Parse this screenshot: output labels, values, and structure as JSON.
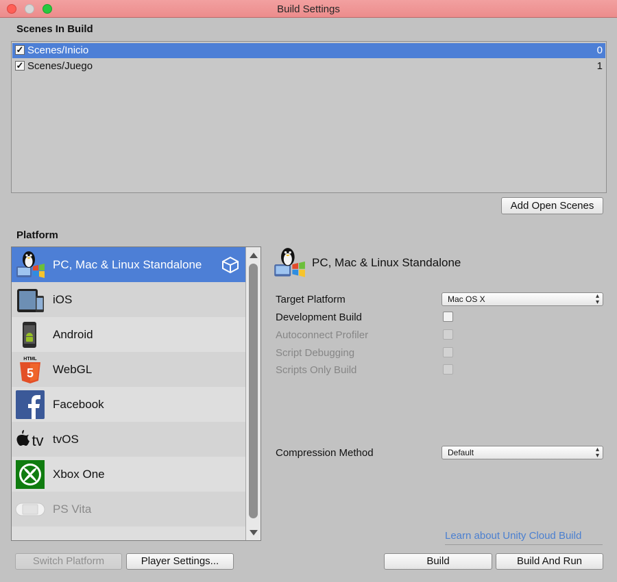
{
  "window": {
    "title": "Build Settings"
  },
  "scenes": {
    "heading": "Scenes In Build",
    "items": [
      {
        "name": "Scenes/Inicio",
        "index": "0",
        "checked": true,
        "selected": true
      },
      {
        "name": "Scenes/Juego",
        "index": "1",
        "checked": true,
        "selected": false
      }
    ],
    "add_open_scenes_label": "Add Open Scenes"
  },
  "platform": {
    "heading": "Platform",
    "items": [
      {
        "label": "PC, Mac & Linux Standalone",
        "icon": "pc-standalone-icon",
        "selected": true
      },
      {
        "label": "iOS",
        "icon": "ios-icon"
      },
      {
        "label": "Android",
        "icon": "android-icon"
      },
      {
        "label": "WebGL",
        "icon": "webgl-icon"
      },
      {
        "label": "Facebook",
        "icon": "facebook-icon"
      },
      {
        "label": "tvOS",
        "icon": "tvos-icon"
      },
      {
        "label": "Xbox One",
        "icon": "xbox-icon"
      },
      {
        "label": "PS Vita",
        "icon": "ps-vita-icon",
        "dimmed": true
      }
    ]
  },
  "settings": {
    "platform_title": "PC, Mac & Linux Standalone",
    "target_platform_label": "Target Platform",
    "target_platform_value": "Mac OS X",
    "development_build_label": "Development Build",
    "autoconnect_profiler_label": "Autoconnect Profiler",
    "script_debugging_label": "Script Debugging",
    "scripts_only_build_label": "Scripts Only Build",
    "compression_method_label": "Compression Method",
    "compression_method_value": "Default",
    "cloud_link": "Learn about Unity Cloud Build"
  },
  "footer": {
    "switch_platform_label": "Switch Platform",
    "player_settings_label": "Player Settings...",
    "build_label": "Build",
    "build_and_run_label": "Build And Run"
  },
  "colors": {
    "selection": "#4d7fd6",
    "titlebar": "#ec8c8c",
    "panel": "#c2c2c2",
    "link": "#4a7fd0"
  }
}
